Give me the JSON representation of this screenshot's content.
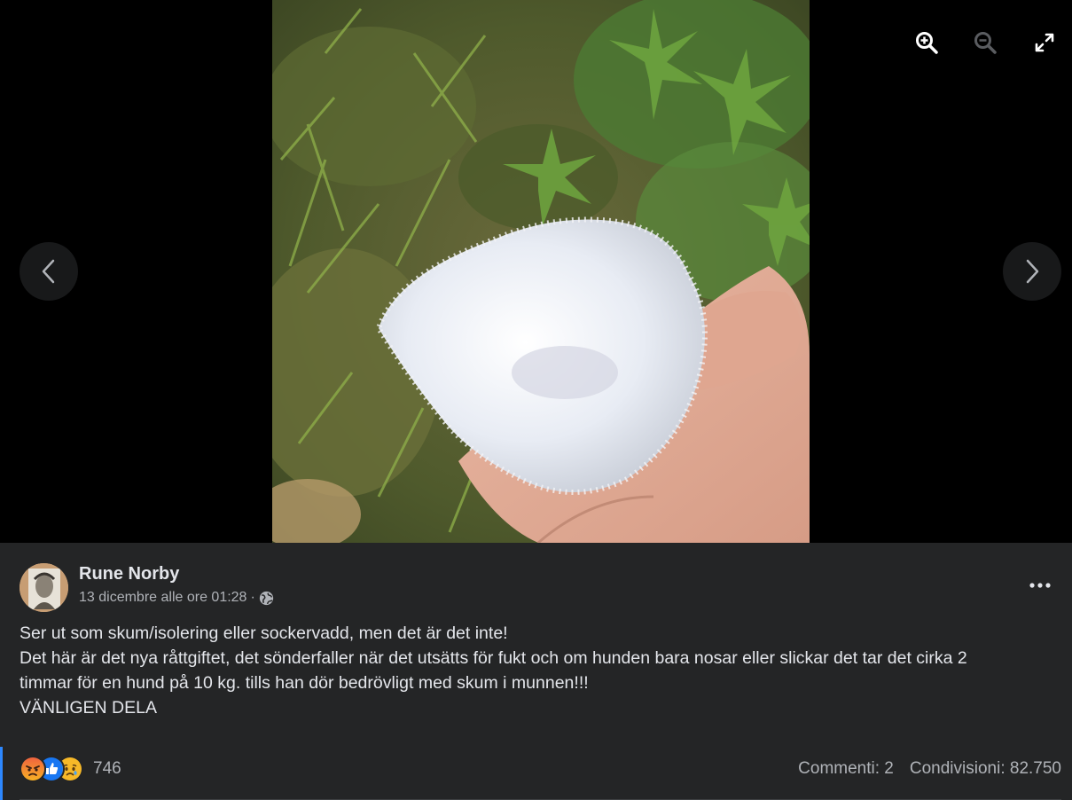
{
  "viewer": {
    "zoom_in_icon": "zoom-in-icon",
    "zoom_out_icon": "zoom-out-icon",
    "fullscreen_icon": "fullscreen-icon",
    "prev_icon": "chevron-left-icon",
    "next_icon": "chevron-right-icon"
  },
  "post": {
    "author": "Rune Norby",
    "timestamp": "13 dicembre alle ore 01:28",
    "separator": "·",
    "privacy_icon": "globe-icon",
    "text_lines": [
      "Ser ut som skum/isolering eller sockervadd, men det är det inte!",
      "Det här är det nya råttgiftet, det sönderfaller när det utsätts för fukt och om hunden bara nosar eller slickar det tar det cirka 2",
      "timmar för en hund på 10 kg. tills han dör bedrövligt med skum i munnen!!!",
      "VÄNLIGEN DELA"
    ]
  },
  "engagement": {
    "reaction_icons": [
      "angry-icon",
      "like-icon",
      "sad-icon"
    ],
    "reaction_count": "746",
    "comments": "Commenti: 2",
    "shares": "Condivisioni: 82.750"
  },
  "colors": {
    "panel_bg": "#242526",
    "text_primary": "#e4e6eb",
    "text_secondary": "#b0b3b8",
    "accent": "#2d88ff"
  }
}
